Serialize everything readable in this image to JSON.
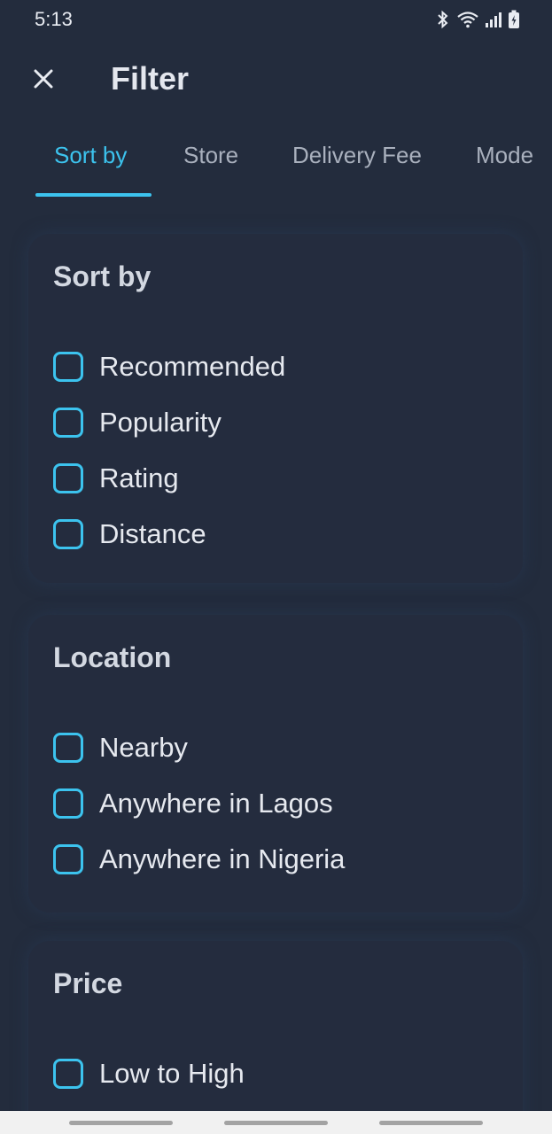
{
  "status_bar": {
    "time": "5:13",
    "icons": [
      "bluetooth-icon",
      "wifi-icon",
      "signal-icon",
      "battery-charging-icon"
    ]
  },
  "header": {
    "close_icon": "close-icon",
    "title": "Filter"
  },
  "tabs": [
    {
      "label": "Sort by",
      "active": true
    },
    {
      "label": "Store",
      "active": false
    },
    {
      "label": "Delivery Fee",
      "active": false
    },
    {
      "label": "Mode",
      "active": false
    }
  ],
  "sections": [
    {
      "title": "Sort by",
      "options": [
        "Recommended",
        "Popularity",
        "Rating",
        "Distance"
      ]
    },
    {
      "title": "Location",
      "options": [
        "Nearby",
        "Anywhere in Lagos",
        "Anywhere in Nigeria"
      ]
    },
    {
      "title": "Price",
      "options": [
        "Low to High"
      ]
    }
  ],
  "colors": {
    "background": "#232c3d",
    "accent": "#3cc3ee",
    "text": "#e6e9ef",
    "muted_text": "#a9b0bd"
  }
}
